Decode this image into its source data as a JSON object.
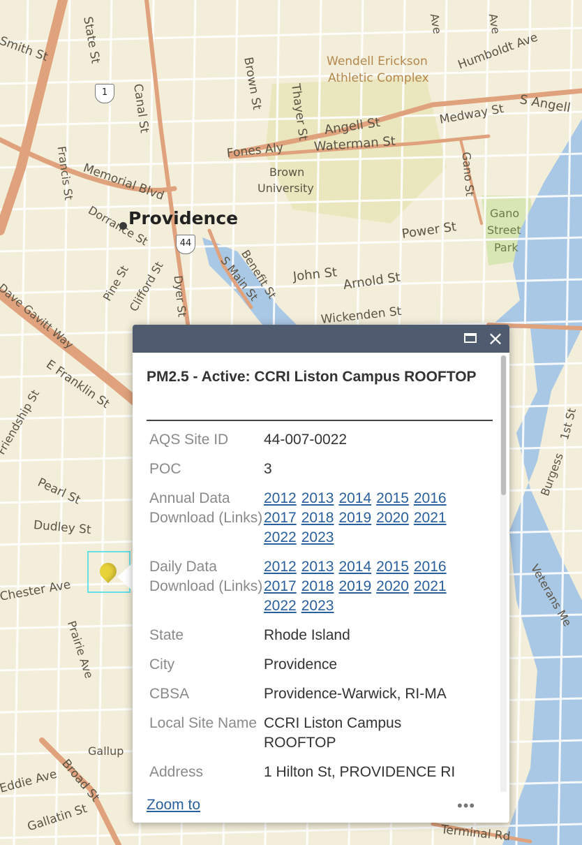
{
  "map": {
    "city_label": "Providence",
    "route_shields": [
      "1",
      "44"
    ],
    "labels": [
      {
        "text": "State St",
        "name": "state-st"
      },
      {
        "text": "Smith St",
        "name": "smith-st"
      },
      {
        "text": "Brown St",
        "name": "brown-st"
      },
      {
        "text": "Thayer St",
        "name": "thayer-st"
      },
      {
        "text": "Wendell Erickson",
        "name": "wendell-erickson"
      },
      {
        "text": "Athletic Complex",
        "name": "athletic-complex"
      },
      {
        "text": "Humboldt Ave",
        "name": "humboldt-ave"
      },
      {
        "text": "S Angell",
        "name": "s-angell"
      },
      {
        "text": "Medway St",
        "name": "medway-st"
      },
      {
        "text": "Angell St",
        "name": "angell-st"
      },
      {
        "text": "Waterman St",
        "name": "waterman-st"
      },
      {
        "text": "Fones Aly",
        "name": "fones-aly"
      },
      {
        "text": "Canal St",
        "name": "canal-st"
      },
      {
        "text": "Francis St",
        "name": "francis-st"
      },
      {
        "text": "Memorial Blvd",
        "name": "memorial-blvd"
      },
      {
        "text": "Brown",
        "name": "brown"
      },
      {
        "text": "University",
        "name": "university"
      },
      {
        "text": "Gano St",
        "name": "gano-st"
      },
      {
        "text": "Gano",
        "name": "gano"
      },
      {
        "text": "Street",
        "name": "street"
      },
      {
        "text": "Park",
        "name": "park"
      },
      {
        "text": "Power St",
        "name": "power-st"
      },
      {
        "text": "Dorrance St",
        "name": "dorrance-st"
      },
      {
        "text": "S Main St",
        "name": "s-main-st"
      },
      {
        "text": "Benefit St",
        "name": "benefit-st"
      },
      {
        "text": "John St",
        "name": "john-st"
      },
      {
        "text": "Arnold St",
        "name": "arnold-st"
      },
      {
        "text": "Wickenden St",
        "name": "wickenden-st"
      },
      {
        "text": "Dyer St",
        "name": "dyer-st"
      },
      {
        "text": "Pine St",
        "name": "pine-st"
      },
      {
        "text": "Clifford St",
        "name": "clifford-st"
      },
      {
        "text": "Dave Gavitt Way",
        "name": "dave-gavitt-way"
      },
      {
        "text": "E Franklin St",
        "name": "e-franklin-st"
      },
      {
        "text": "Friendship St",
        "name": "friendship-st"
      },
      {
        "text": "Pearl St",
        "name": "pearl-st"
      },
      {
        "text": "Dudley St",
        "name": "dudley-st"
      },
      {
        "text": "Chester Ave",
        "name": "chester-ave"
      },
      {
        "text": "Prairie Ave",
        "name": "prairie-ave"
      },
      {
        "text": "Gallup",
        "name": "gallup"
      },
      {
        "text": "Broad St",
        "name": "broad-st"
      },
      {
        "text": "Eddie Ave",
        "name": "eddie-ave"
      },
      {
        "text": "Gallatin St",
        "name": "gallatin-st"
      },
      {
        "text": "Terminal Rd",
        "name": "terminal-rd"
      },
      {
        "text": "Veterans Me",
        "name": "veterans-me"
      },
      {
        "text": "Burgess",
        "name": "burgess"
      },
      {
        "text": "1st St",
        "name": "1st-st"
      },
      {
        "text": "Ave",
        "name": "ave-1"
      },
      {
        "text": "Ave",
        "name": "ave-2"
      }
    ]
  },
  "popup": {
    "title": "PM2.5 - Active: CCRI Liston Campus ROOFTOP",
    "fields": [
      {
        "label": "AQS Site ID",
        "value": "44-007-0022"
      },
      {
        "label": "POC",
        "value": "3"
      },
      {
        "label": "Annual Data Download (Links)",
        "links": [
          "2012",
          "2013",
          "2014",
          "2015",
          "2016",
          "2017",
          "2018",
          "2019",
          "2020",
          "2021",
          "2022",
          "2023"
        ]
      },
      {
        "label": "Daily Data Download (Links)",
        "links": [
          "2012",
          "2013",
          "2014",
          "2015",
          "2016",
          "2017",
          "2018",
          "2019",
          "2020",
          "2021",
          "2022",
          "2023"
        ]
      },
      {
        "label": "State",
        "value": "Rhode Island"
      },
      {
        "label": "City",
        "value": "Providence"
      },
      {
        "label": "CBSA",
        "value": "Providence-Warwick, RI-MA"
      },
      {
        "label": "Local Site Name",
        "value": "CCRI Liston Campus ROOFTOP"
      },
      {
        "label": "Address",
        "value": "1 Hilton St, PROVIDENCE RI"
      }
    ],
    "zoom_label": "Zoom to",
    "more_label": "•••"
  },
  "colors": {
    "header": "#4f5c6f",
    "water": "#a9c8e6",
    "road_major": "#e0a27c",
    "park": "#d8e6b4",
    "base": "#f3eed9"
  }
}
